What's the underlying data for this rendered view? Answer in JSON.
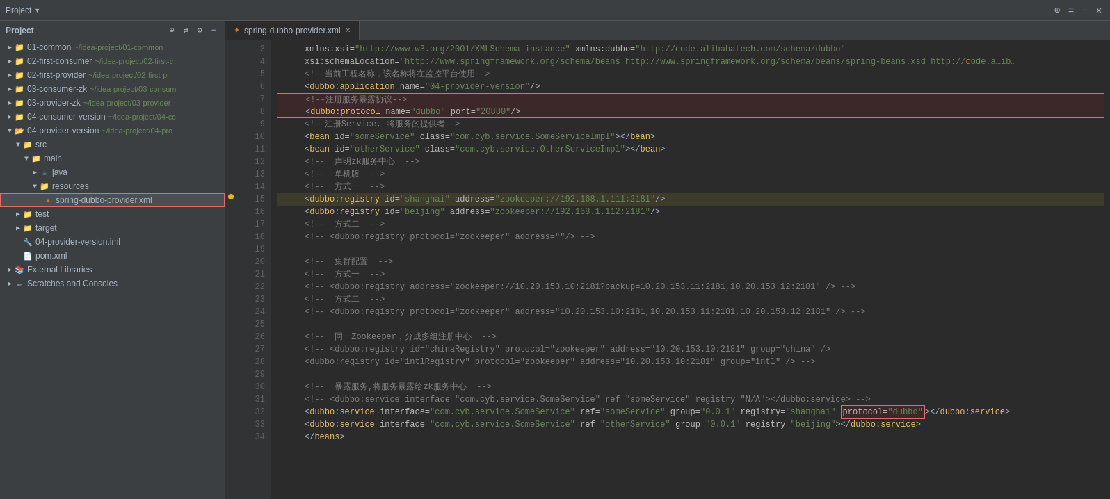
{
  "topbar": {
    "project_label": "Project",
    "icons": [
      "⊕",
      "≡",
      "−",
      "✕"
    ]
  },
  "sidebar": {
    "items": [
      {
        "id": "01-common",
        "label": "01-common",
        "path": "~/idea-project/01-common",
        "level": 0,
        "type": "module",
        "expanded": false,
        "arrow": "▶"
      },
      {
        "id": "02-first-consumer",
        "label": "02-first-consumer",
        "path": "~/idea-project/02-first-c",
        "level": 0,
        "type": "module",
        "expanded": false,
        "arrow": "▶"
      },
      {
        "id": "02-first-provider",
        "label": "02-first-provider",
        "path": "~/idea-project/02-first-p",
        "level": 0,
        "type": "module",
        "expanded": false,
        "arrow": "▶"
      },
      {
        "id": "03-consumer-zk",
        "label": "03-consumer-zk",
        "path": "~/idea-project/03-consum",
        "level": 0,
        "type": "module",
        "expanded": false,
        "arrow": "▶"
      },
      {
        "id": "03-provider-zk",
        "label": "03-provider-zk",
        "path": "~/idea-project/03-provider-",
        "level": 0,
        "type": "module",
        "expanded": false,
        "arrow": "▶"
      },
      {
        "id": "04-consumer-version",
        "label": "04-consumer-version",
        "path": "~/idea-project/04-cc",
        "level": 0,
        "type": "module",
        "expanded": false,
        "arrow": "▶"
      },
      {
        "id": "04-provider-version",
        "label": "04-provider-version",
        "path": "~/idea-project/04-pro",
        "level": 0,
        "type": "module",
        "expanded": true,
        "arrow": "▼"
      },
      {
        "id": "src",
        "label": "src",
        "level": 1,
        "type": "folder",
        "expanded": true,
        "arrow": "▼"
      },
      {
        "id": "main",
        "label": "main",
        "level": 2,
        "type": "folder",
        "expanded": true,
        "arrow": "▼"
      },
      {
        "id": "java",
        "label": "java",
        "level": 3,
        "type": "java",
        "expanded": false,
        "arrow": "▶"
      },
      {
        "id": "resources",
        "label": "resources",
        "level": 3,
        "type": "res",
        "expanded": true,
        "arrow": "▼"
      },
      {
        "id": "spring-dubbo-provider",
        "label": "spring-dubbo-provider.xml",
        "level": 4,
        "type": "xml",
        "expanded": false,
        "arrow": "",
        "selected": true
      },
      {
        "id": "test",
        "label": "test",
        "level": 1,
        "type": "folder",
        "expanded": false,
        "arrow": "▶"
      },
      {
        "id": "target",
        "label": "target",
        "level": 1,
        "type": "folder",
        "expanded": false,
        "arrow": "▶"
      },
      {
        "id": "04-provider-version-iml",
        "label": "04-provider-version.iml",
        "level": 1,
        "type": "iml",
        "expanded": false,
        "arrow": ""
      },
      {
        "id": "pom-xml",
        "label": "pom.xml",
        "level": 1,
        "type": "pom",
        "expanded": false,
        "arrow": ""
      },
      {
        "id": "external-libraries",
        "label": "External Libraries",
        "level": 0,
        "type": "lib",
        "expanded": false,
        "arrow": "▶"
      },
      {
        "id": "scratches",
        "label": "Scratches and Consoles",
        "level": 0,
        "type": "scratch",
        "expanded": false,
        "arrow": "▶"
      }
    ]
  },
  "editor": {
    "tab_label": "spring-dubbo-provider.xml",
    "lines": [
      {
        "num": 3,
        "content": "    xmlns:xsi=\"http://www.w3.org/2001/XMLSchema-instance\" xmlns:dubbo=\"http://code.alibabatech.com/schema/dubbo\"",
        "type": "normal"
      },
      {
        "num": 4,
        "content": "    xsi:schemaLocation=\"http://www.springframework.org/schema/beans http://www.springframework.org/schema/beans/spring-beans.xsd http://code.a…ib…",
        "type": "normal"
      },
      {
        "num": 5,
        "content": "    <!--当前工程名称，该名称将在监控平台使用-->",
        "type": "comment"
      },
      {
        "num": 6,
        "content": "    <dubbo:application name=\"04-provider-version\"/>",
        "type": "normal"
      },
      {
        "num": 7,
        "content": "    <!--注册服务暴露协议-->",
        "type": "comment",
        "redbox_start": true
      },
      {
        "num": 8,
        "content": "    <dubbo:protocol name=\"dubbo\" port=\"20880\"/>",
        "type": "normal",
        "redbox_end": true
      },
      {
        "num": 9,
        "content": "    <!--注册Service, 将服务的提供者-->",
        "type": "comment"
      },
      {
        "num": 10,
        "content": "    <bean id=\"someService\" class=\"com.cyb.service.SomeServiceImpl\"></bean>",
        "type": "normal"
      },
      {
        "num": 11,
        "content": "    <bean id=\"otherService\" class=\"com.cyb.service.OtherServiceImpl\"></bean>",
        "type": "normal"
      },
      {
        "num": 12,
        "content": "    <!--  声明zk服务中心  -->",
        "type": "comment"
      },
      {
        "num": 13,
        "content": "    <!--  单机版  -->",
        "type": "comment"
      },
      {
        "num": 14,
        "content": "    <!--  方式一  -->",
        "type": "comment"
      },
      {
        "num": 15,
        "content": "    <dubbo:registry id=\"shanghai\" address=\"zookeeper://192.168.1.111:2181\"/>",
        "type": "normal",
        "warning": true,
        "yellowbg": true
      },
      {
        "num": 16,
        "content": "    <dubbo:registry id=\"beijing\" address=\"zookeeper://192.168.1.112:2181\"/>",
        "type": "normal"
      },
      {
        "num": 17,
        "content": "    <!--  方式二  -->",
        "type": "comment"
      },
      {
        "num": 18,
        "content": "    <!-- <dubbo:registry protocol=\"zookeeper\" address=\"\"/> -->",
        "type": "comment"
      },
      {
        "num": 19,
        "content": "",
        "type": "empty"
      },
      {
        "num": 20,
        "content": "    <!--  集群配置  -->",
        "type": "comment"
      },
      {
        "num": 21,
        "content": "    <!--  方式一  -->",
        "type": "comment"
      },
      {
        "num": 22,
        "content": "    <!-- <dubbo:registry address=\"zookeeper://10.20.153.10:2181?backup=10.20.153.11:2181,10.20.153.12:2181\" /> -->",
        "type": "comment"
      },
      {
        "num": 23,
        "content": "    <!--  方式二  -->",
        "type": "comment"
      },
      {
        "num": 24,
        "content": "    <!-- <dubbo:registry protocol=\"zookeeper\" address=\"10.20.153.10:2181,10.20.153.11:2181,10.20.153.12:2181\" /> -->",
        "type": "comment"
      },
      {
        "num": 25,
        "content": "",
        "type": "empty"
      },
      {
        "num": 26,
        "content": "    <!--  同一Zookeeper，分成多组注册中心  -->",
        "type": "comment"
      },
      {
        "num": 27,
        "content": "    <!-- <dubbo:registry id=\"chinaRegistry\" protocol=\"zookeeper\" address=\"10.20.153.10:2181\" group=\"china\" />",
        "type": "comment"
      },
      {
        "num": 28,
        "content": "    <dubbo:registry id=\"intlRegistry\" protocol=\"zookeeper\" address=\"10.20.153.10:2181\" group=\"intl\" /> -->",
        "type": "comment"
      },
      {
        "num": 29,
        "content": "",
        "type": "empty"
      },
      {
        "num": 30,
        "content": "    <!--  暴露服务,将服务暴露给zk服务中心  -->",
        "type": "comment"
      },
      {
        "num": 31,
        "content": "    <!-- <dubbo:service interface=\"com.cyb.service.SomeService\" ref=\"someService\" registry=\"N/A\"></dubbo:service> -->",
        "type": "comment"
      },
      {
        "num": 32,
        "content": "    <dubbo:service interface=\"com.cyb.service.SomeService\" ref=\"someService\" group=\"0.0.1\" registry=\"shanghai\" protocol=\"dubbo\"></dubbo:service>",
        "type": "normal",
        "redbox_protocol": true
      },
      {
        "num": 33,
        "content": "    <dubbo:service interface=\"com.cyb.service.SomeService\" ref=\"otherService\" group=\"0.0.1\" registry=\"beijing\"></dubbo:service>",
        "type": "normal"
      },
      {
        "num": 34,
        "content": "    </beans>",
        "type": "normal"
      }
    ]
  }
}
